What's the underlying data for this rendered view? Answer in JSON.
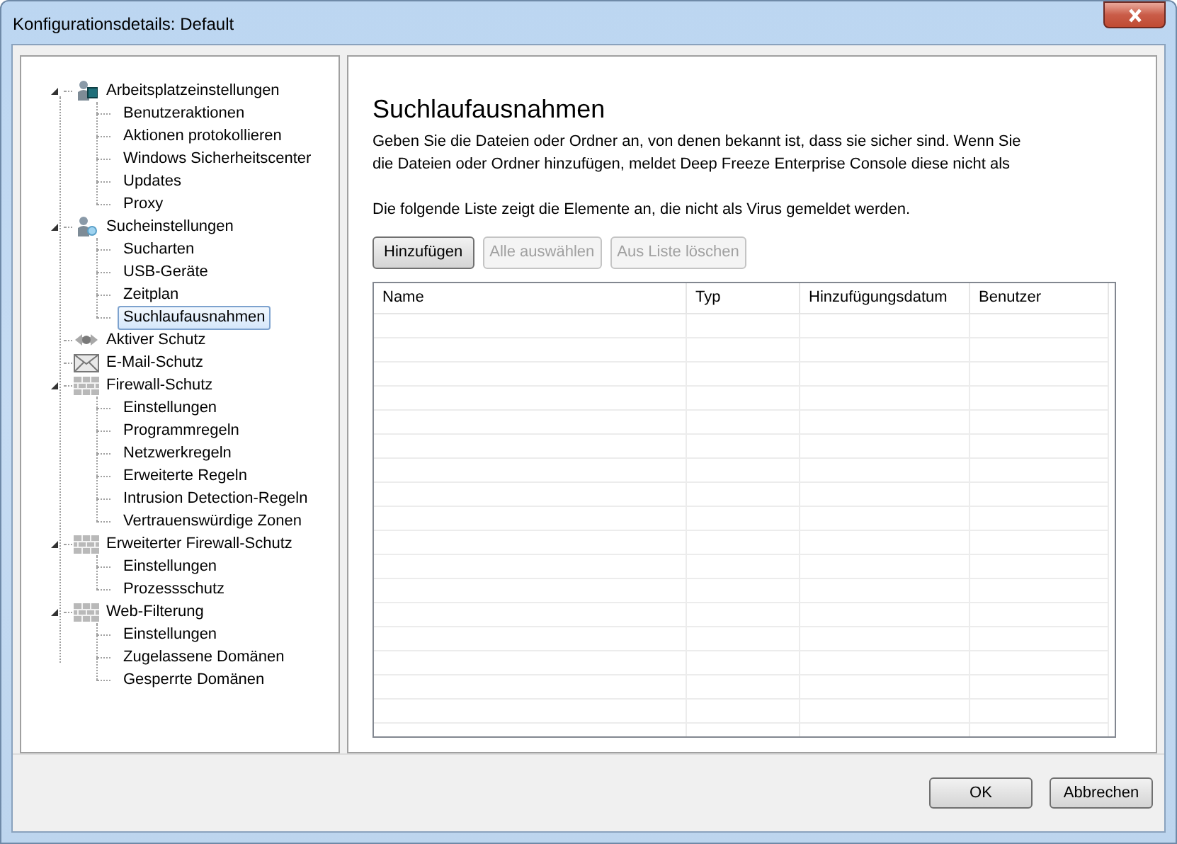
{
  "window": {
    "title": "Konfigurationsdetails: Default"
  },
  "tree": [
    {
      "label": "Arbeitsplatzeinstellungen",
      "kind": "workstation",
      "expanded": true,
      "selected": false,
      "children": [
        {
          "label": "Benutzeraktionen",
          "selected": false
        },
        {
          "label": "Aktionen protokollieren",
          "selected": false
        },
        {
          "label": "Windows Sicherheitscenter",
          "selected": false
        },
        {
          "label": "Updates",
          "selected": false
        },
        {
          "label": "Proxy",
          "selected": false
        }
      ]
    },
    {
      "label": "Sucheinstellungen",
      "kind": "scan",
      "expanded": true,
      "selected": false,
      "children": [
        {
          "label": "Sucharten",
          "selected": false
        },
        {
          "label": "USB-Geräte",
          "selected": false
        },
        {
          "label": "Zeitplan",
          "selected": false
        },
        {
          "label": "Suchlaufausnahmen",
          "selected": true
        }
      ]
    },
    {
      "label": "Aktiver Schutz",
      "kind": "active",
      "selected": false
    },
    {
      "label": "E-Mail-Schutz",
      "kind": "mail",
      "selected": false
    },
    {
      "label": "Firewall-Schutz",
      "kind": "firewall",
      "expanded": true,
      "selected": false,
      "children": [
        {
          "label": "Einstellungen",
          "selected": false
        },
        {
          "label": "Programmregeln",
          "selected": false
        },
        {
          "label": "Netzwerkregeln",
          "selected": false
        },
        {
          "label": "Erweiterte Regeln",
          "selected": false
        },
        {
          "label": "Intrusion Detection-Regeln",
          "selected": false
        },
        {
          "label": "Vertrauenswürdige Zonen",
          "selected": false
        }
      ]
    },
    {
      "label": "Erweiterter Firewall-Schutz",
      "kind": "firewall",
      "expanded": true,
      "selected": false,
      "children": [
        {
          "label": "Einstellungen",
          "selected": false
        },
        {
          "label": "Prozessschutz",
          "selected": false
        }
      ]
    },
    {
      "label": "Web-Filterung",
      "kind": "firewall",
      "expanded": true,
      "selected": false,
      "children": [
        {
          "label": "Einstellungen",
          "selected": false
        },
        {
          "label": "Zugelassene Domänen",
          "selected": false
        },
        {
          "label": "Gesperrte Domänen",
          "selected": false
        }
      ]
    }
  ],
  "page": {
    "heading": "Suchlaufausnahmen",
    "description": "Geben Sie die Dateien oder Ordner an, von denen bekannt ist, dass sie sicher sind. Wenn Sie die Dateien oder Ordner hinzufügen, meldet Deep Freeze Enterprise Console diese nicht als",
    "list_note": "Die folgende Liste zeigt die Elemente an, die nicht als Virus gemeldet werden.",
    "buttons": [
      {
        "label": "Hinzufügen",
        "disabled": false
      },
      {
        "label": "Alle auswählen",
        "disabled": true
      },
      {
        "label": "Aus Liste löschen",
        "disabled": true
      }
    ],
    "table": {
      "columns": [
        "Name",
        "Typ",
        "Hinzufügungsdatum",
        "Benutzer"
      ]
    }
  },
  "footer_buttons": [
    "OK",
    "Abbrechen"
  ]
}
